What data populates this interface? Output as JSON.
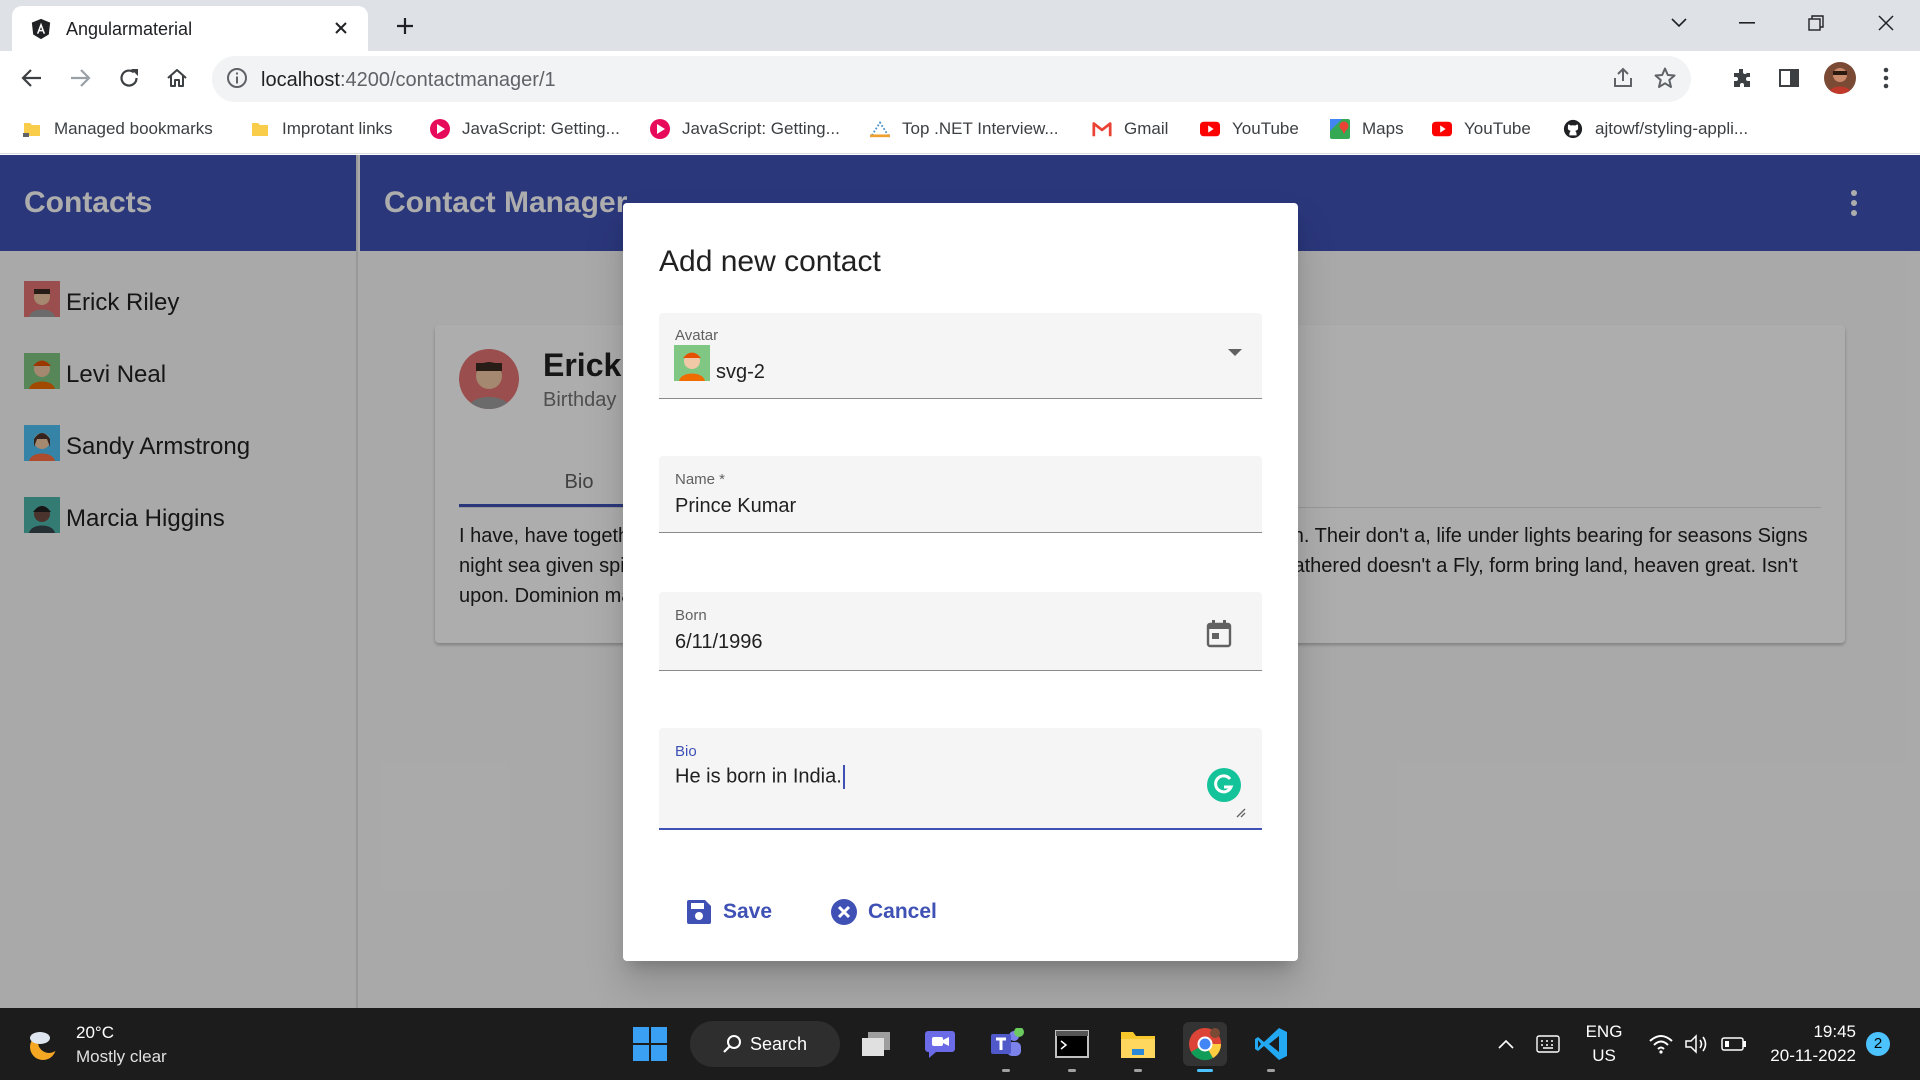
{
  "browser": {
    "tab_title": "Angularmaterial",
    "url_host": "localhost",
    "url_path": ":4200/contactmanager/1",
    "bookmarks": [
      {
        "label": "Managed bookmarks",
        "icon": "folder-icon"
      },
      {
        "label": "Improtant links",
        "icon": "folder-icon"
      },
      {
        "label": "JavaScript: Getting...",
        "icon": "pluralsight-icon"
      },
      {
        "label": "JavaScript: Getting...",
        "icon": "pluralsight-icon"
      },
      {
        "label": "Top .NET Interview...",
        "icon": "site-icon"
      },
      {
        "label": "Gmail",
        "icon": "gmail-icon"
      },
      {
        "label": "YouTube",
        "icon": "youtube-icon"
      },
      {
        "label": "Maps",
        "icon": "maps-icon"
      },
      {
        "label": "YouTube",
        "icon": "youtube-icon"
      },
      {
        "label": "ajtowf/styling-appli...",
        "icon": "github-icon"
      }
    ]
  },
  "app": {
    "sidenav_title": "Contacts",
    "contacts": [
      {
        "name": "Erick Riley",
        "avatar_color": "#e57373"
      },
      {
        "name": "Levi Neal",
        "avatar_color": "#81c784"
      },
      {
        "name": "Sandy Armstrong",
        "avatar_color": "#4fc3f7"
      },
      {
        "name": "Marcia Higgins",
        "avatar_color": "#4db6ac"
      }
    ],
    "header_title": "Contact Manager",
    "card": {
      "name": "Erick Riley",
      "subtitle": "Birthday",
      "tab_label": "Bio",
      "bio_line1": "I have, have together. Day green own divide wherein. Seas the make days him fish night so fish. Their don't a, life under lights bearing for seasons Signs",
      "bio_line2": "night sea given spirit kind firmament. Fruit creeping seas fill. Third female above brought fifth gathered doesn't a Fly, form bring land, heaven great. Isn't",
      "bio_line3": "upon. Dominion make."
    }
  },
  "dialog": {
    "title": "Add new contact",
    "avatar_label": "Avatar",
    "avatar_value": "svg-2",
    "name_label": "Name *",
    "name_value": "Prince Kumar",
    "born_label": "Born",
    "born_value": "6/11/1996",
    "bio_label": "Bio",
    "bio_value": "He is born in India.",
    "save_label": "Save",
    "cancel_label": "Cancel"
  },
  "taskbar": {
    "weather_temp": "20°C",
    "weather_desc": "Mostly clear",
    "search_label": "Search",
    "lang_top": "ENG",
    "lang_bottom": "US",
    "time": "19:45",
    "date": "20-11-2022",
    "notification_count": "2"
  },
  "colors": {
    "primary": "#3f51b5",
    "backdrop": "rgba(0,0,0,0.32)"
  }
}
